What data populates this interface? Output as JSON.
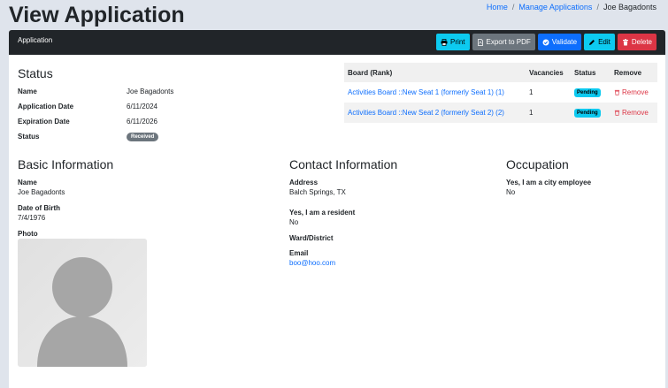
{
  "page": {
    "title": "View Application"
  },
  "breadcrumb": {
    "home": "Home",
    "manage": "Manage Applications",
    "current": "Joe Bagadonts",
    "sep": "/"
  },
  "card": {
    "header_title": "Application"
  },
  "toolbar": {
    "print": "Print",
    "export_pdf": "Export to PDF",
    "validate": "Validate",
    "edit": "Edit",
    "delete": "Delete"
  },
  "status": {
    "title": "Status",
    "name_label": "Name",
    "name_value": "Joe Bagadonts",
    "app_date_label": "Application Date",
    "app_date_value": "6/11/2024",
    "exp_date_label": "Expiration Date",
    "exp_date_value": "6/11/2026",
    "status_label": "Status",
    "status_value": "Received"
  },
  "boards": {
    "headers": {
      "board": "Board (Rank)",
      "vacancies": "Vacancies",
      "status": "Status",
      "remove": "Remove"
    },
    "rows": [
      {
        "board": "Activities Board ::New Seat 1 (formerly Seat 1) (1)",
        "vacancies": "1",
        "status": "Pending",
        "remove": "Remove"
      },
      {
        "board": "Activities Board ::New Seat 2 (formerly Seat 2) (2)",
        "vacancies": "1",
        "status": "Pending",
        "remove": "Remove"
      }
    ]
  },
  "basic": {
    "title": "Basic Information",
    "name_label": "Name",
    "name_value": "Joe Bagadonts",
    "dob_label": "Date of Birth",
    "dob_value": "7/4/1976",
    "photo_label": "Photo"
  },
  "contact": {
    "title": "Contact Information",
    "address_label": "Address",
    "address_value": "Balch Springs, TX",
    "resident_label": "Yes, I am a resident",
    "resident_value": "No",
    "ward_label": "Ward/District",
    "email_label": "Email",
    "email_value": "boo@hoo.com"
  },
  "occupation": {
    "title": "Occupation",
    "city_employee_label": "Yes, I am a city employee",
    "city_employee_value": "No"
  },
  "colors": {
    "primary": "#0d6efd",
    "info": "#0dcaf0",
    "secondary": "#6c757d",
    "danger": "#dc3545",
    "dark": "#212529"
  }
}
